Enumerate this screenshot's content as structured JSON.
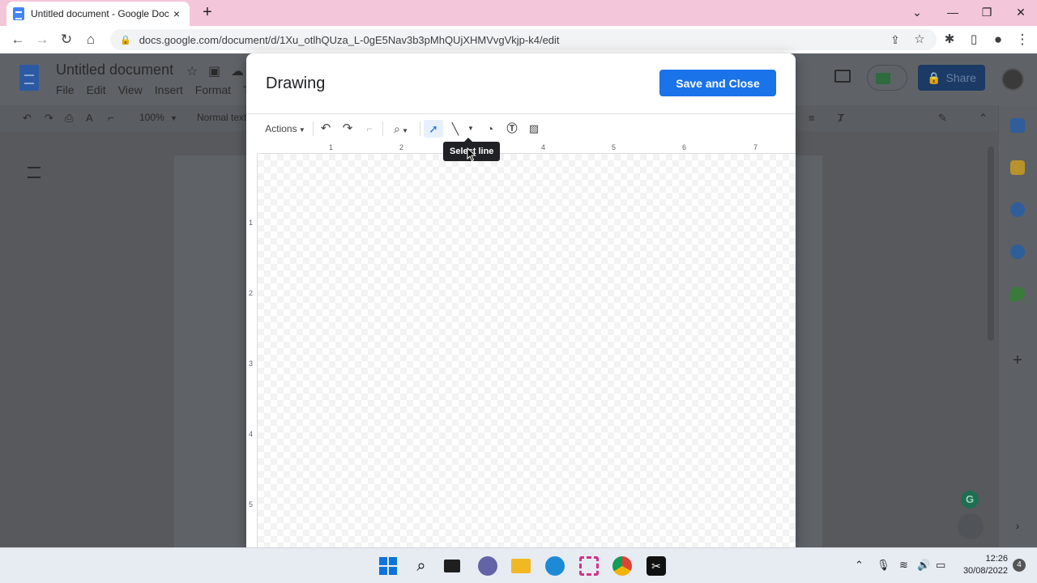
{
  "browser": {
    "tab_title": "Untitled document - Google Doc",
    "tab_close": "×",
    "new_tab": "+",
    "url": "docs.google.com/document/d/1Xu_otlhQUza_L-0gE5Nav3b3pMhQUjXHMVvgVkjp-k4/edit",
    "window_controls": {
      "minimize": "⌄",
      "restore": "—",
      "maximize": "❐",
      "close": "✕"
    }
  },
  "docs": {
    "title": "Untitled document",
    "menu": [
      "File",
      "Edit",
      "View",
      "Insert",
      "Format",
      "To"
    ],
    "zoom": "100%",
    "style": "Normal text",
    "share_label": "Share"
  },
  "dialog": {
    "title": "Drawing",
    "save_close_label": "Save and Close",
    "actions_label": "Actions",
    "tooltip": "Select line",
    "ruler_h": [
      "1",
      "2",
      "3",
      "4",
      "5",
      "6",
      "7"
    ],
    "ruler_v": [
      "1",
      "2",
      "3",
      "4",
      "5"
    ]
  },
  "taskbar": {
    "time": "12:26",
    "date": "30/08/2022",
    "notifications": "4"
  },
  "colors": {
    "accent": "#1a73e8",
    "tab_bar": "#f4c6d9"
  }
}
